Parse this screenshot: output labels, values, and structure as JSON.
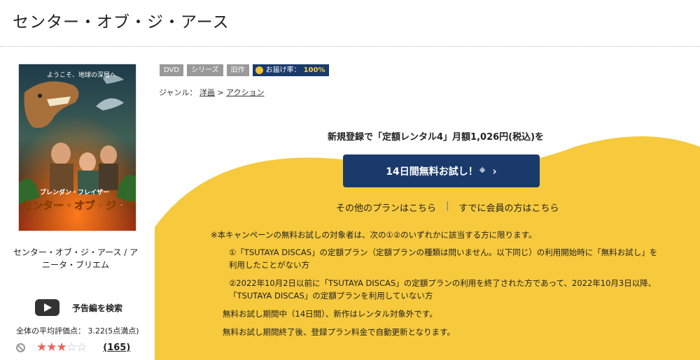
{
  "page": {
    "title": "センター・オブ・ジ・アース"
  },
  "poster": {
    "text_top": "ようこそ、地球の深層へ",
    "text_actor": "ブレンダン・フレイザー",
    "text_logo": "センター・オブ・ジ・アース"
  },
  "left": {
    "caption": "センター・オブ・ジ・アース / アニータ・ブリエム",
    "trailer_label": "予告編を検索",
    "avg_rating": "全体の平均評価点： 3.22(5点満点)",
    "rating_stars": 3,
    "rating_max": 5,
    "review_count": "(165)"
  },
  "tags": {
    "dvd": "DVD",
    "series": "シリーズ",
    "old": "旧作",
    "delivery_label": "お届け率：",
    "delivery_value": "100%"
  },
  "genre": {
    "label": "ジャンル：",
    "item1": "洋画",
    "sep": ">",
    "item2": "アクション"
  },
  "promo": {
    "headline": "新規登録で「定額レンタル4」月額1,026円(税込)を",
    "cta_label": "14日間無料お試し！",
    "cta_note": "※",
    "cta_chevron": "›",
    "other_plans": "その他のプランはこちら",
    "link_separator": "|",
    "member_login": "すでに会員の方はこちら",
    "notes": [
      "※本キャンペーンの無料お試しの対象者は、次の①②のいずれかに該当する方に限ります。",
      "①「TSUTAYA DISCAS」の定額プラン（定額プランの種類は問いません。以下同じ）の利用開始時に「無料お試し」を",
      "利用したことがない方",
      "②2022年10月2日以前に「TSUTAYA DISCAS」の定額プランの利用を終了された方であって、2022年10月3日以降、",
      "「TSUTAYA DISCAS」の定額プランを利用していない方",
      "無料お試し期間中（14日間）、新作はレンタル対象外です。",
      "無料お試し期間終了後、登録プラン料金で自動更新となります。"
    ]
  },
  "colors": {
    "accent_navy": "#1a3a6b",
    "promo_yellow": "#f7c93c",
    "star_red": "#e8645a"
  }
}
